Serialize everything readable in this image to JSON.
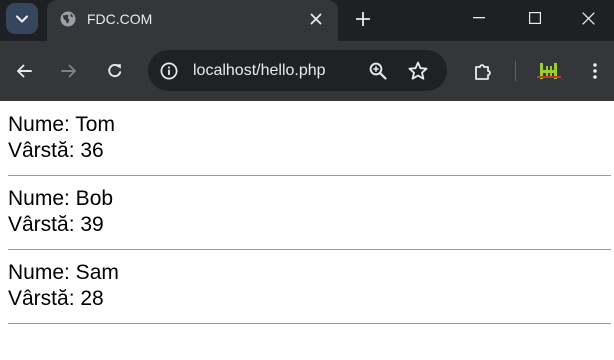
{
  "browser": {
    "tab": {
      "title": "FDC.COM",
      "favicon": "globe-icon"
    },
    "address_bar": {
      "url": "localhost/hello.php"
    },
    "icons": {
      "tab_search": "chevron-down-icon",
      "close_tab": "close-icon",
      "new_tab": "plus-icon",
      "minimize": "minimize-icon",
      "maximize": "maximize-icon",
      "close_window": "close-icon",
      "back": "arrow-left-icon",
      "forward": "arrow-right-icon",
      "reload": "reload-icon",
      "site_info": "site-info-icon",
      "zoom": "zoom-icon",
      "bookmark": "star-icon",
      "extensions": "puzzle-icon",
      "extension_app": "extension-app-icon",
      "menu": "kebab-menu-icon"
    },
    "colors": {
      "tabstrip_bg": "#1f2023",
      "toolbar_bg": "#35363a",
      "omnibox_bg": "#202124",
      "tab_search_bg": "#37465f",
      "extension_accent": "#9acd32"
    }
  },
  "page": {
    "people": [
      {
        "name_line": "Nume: Tom",
        "age_line": "Vârstă: 36"
      },
      {
        "name_line": "Nume: Bob",
        "age_line": "Vârstă: 39"
      },
      {
        "name_line": "Nume: Sam",
        "age_line": "Vârstă: 28"
      }
    ]
  }
}
